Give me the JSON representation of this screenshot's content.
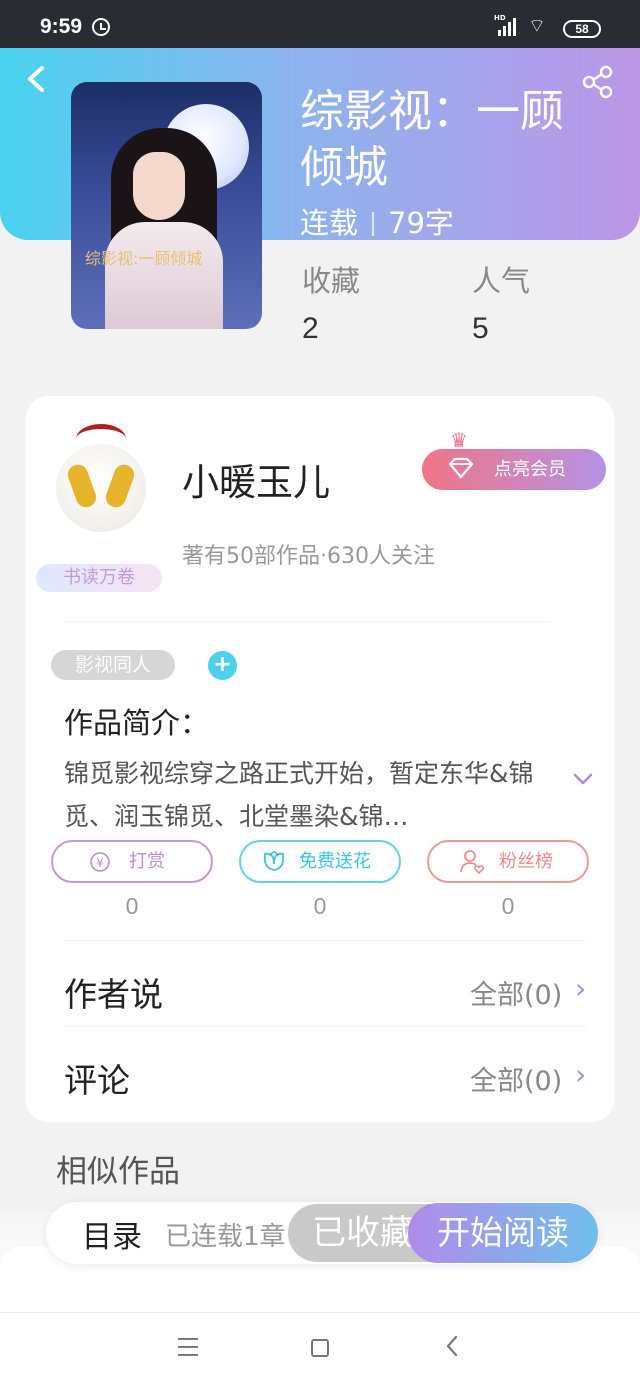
{
  "status_bar": {
    "time": "9:59",
    "network": "HD",
    "battery": "58"
  },
  "header": {
    "back_icon": "back-arrow-icon",
    "share_icon": "share-icon"
  },
  "book": {
    "title": "综影视：一顾倾城",
    "cover_text": "综影视:一顾倾城",
    "status": "连载",
    "word_count": "79字",
    "stats": [
      {
        "label": "收藏",
        "value": "2"
      },
      {
        "label": "人气",
        "value": "5"
      }
    ]
  },
  "author": {
    "name": "小暖玉儿",
    "badge": "书读万卷",
    "stats": "著有50部作品·630人关注",
    "vip_button": "点亮会员"
  },
  "tags": [
    "影视同人"
  ],
  "intro": {
    "title": "作品简介：",
    "text": "锦觅影视综穿之路正式开始，暂定东华&锦觅、润玉锦觅、北堂墨染&锦…"
  },
  "actions": [
    {
      "label": "打赏",
      "icon": "yen-icon",
      "count": "0"
    },
    {
      "label": "免费送花",
      "icon": "flower-icon",
      "count": "0"
    },
    {
      "label": "粉丝榜",
      "icon": "fans-icon",
      "count": "0"
    }
  ],
  "rows": [
    {
      "label": "作者说",
      "value": "全部(0)"
    },
    {
      "label": "评论",
      "value": "全部(0)"
    }
  ],
  "similar_title": "相似作品",
  "bottom_bar": {
    "toc": "目录",
    "toc_count": "已连载1章",
    "collected": "已收藏",
    "read": "开始阅读"
  },
  "colors": {
    "accent_cyan": "#49d3ef",
    "accent_purple": "#bd96e8",
    "vip_pink": "#f07585"
  }
}
